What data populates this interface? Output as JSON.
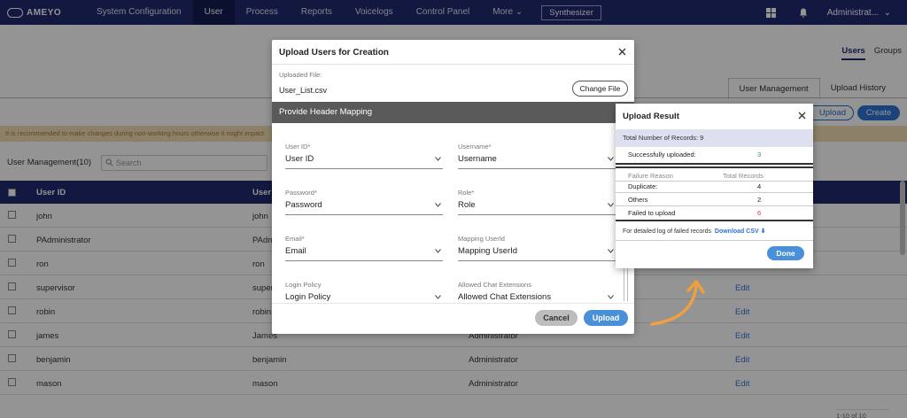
{
  "nav": {
    "brand": "AMEYO",
    "items": [
      "System Configuration",
      "User",
      "Process",
      "Reports",
      "Voicelogs",
      "Control Panel",
      "More"
    ],
    "synth": "Synthesizer",
    "admin": "Administrat..."
  },
  "page": {
    "top_tabs": [
      "Users",
      "Groups"
    ],
    "sub_tabs": [
      "User Management",
      "Upload History"
    ],
    "upload_btn": "Upload",
    "create_btn": "Create",
    "warning": "It is recommended to make changes during non-working hours otherwise it might impact",
    "list_title": "User Management(10)",
    "search_placeholder": "Search",
    "columns": [
      "User ID",
      "User N"
    ],
    "rows": [
      {
        "id": "john",
        "name": "john",
        "role": "",
        "edit": ""
      },
      {
        "id": "PAdministrator",
        "name": "PAdm",
        "role": "",
        "edit": ""
      },
      {
        "id": "ron",
        "name": "ron",
        "role": "",
        "edit": ""
      },
      {
        "id": "supervisor",
        "name": "super",
        "role": "",
        "edit": "Edit"
      },
      {
        "id": "robin",
        "name": "robin",
        "role": "",
        "edit": "Edit"
      },
      {
        "id": "james",
        "name": "James",
        "role": "Administrator",
        "edit": "Edit"
      },
      {
        "id": "benjamin",
        "name": "benjamin",
        "role": "Administrator",
        "edit": "Edit"
      },
      {
        "id": "mason",
        "name": "mason",
        "role": "Administrator",
        "edit": "Edit"
      }
    ],
    "pager": "1-10 of 10"
  },
  "modal": {
    "title": "Upload Users for Creation",
    "uploaded_label": "Uploaded File:",
    "file_name": "User_List.csv",
    "change_file": "Change File",
    "header_mapping": "Provide Header Mapping",
    "fields": [
      {
        "label": "User ID*",
        "value": "User ID"
      },
      {
        "label": "Username*",
        "value": "Username"
      },
      {
        "label": "Password*",
        "value": "Password"
      },
      {
        "label": "Role*",
        "value": "Role"
      },
      {
        "label": "Email*",
        "value": "Email"
      },
      {
        "label": "Mapping UserId",
        "value": "Mapping UserId"
      },
      {
        "label": "Login Policy",
        "value": "Login Policy"
      },
      {
        "label": "Allowed Chat Extensions",
        "value": "Allowed Chat Extensions"
      }
    ],
    "cancel": "Cancel",
    "upload": "Upload"
  },
  "result": {
    "title": "Upload Result",
    "total_label": "Total Number of Records:",
    "total_value": "9",
    "success_label": "Successfully uploaded:",
    "success_value": "3",
    "failure_header": "Failure Reason",
    "records_header": "Total Records",
    "duplicate_label": "Duplicate:",
    "duplicate_value": "4",
    "others_label": "Others",
    "others_value": "2",
    "failed_label": "Failed to upload",
    "failed_value": "6",
    "log_note": "For detailed log of failed records",
    "download": "Download CSV",
    "done": "Done"
  },
  "colors": {
    "nav": "#1f2a6e",
    "accent": "#4a90d9",
    "success": "#2aa05a",
    "failure": "#d9363e",
    "arrow": "#f0a03c"
  }
}
